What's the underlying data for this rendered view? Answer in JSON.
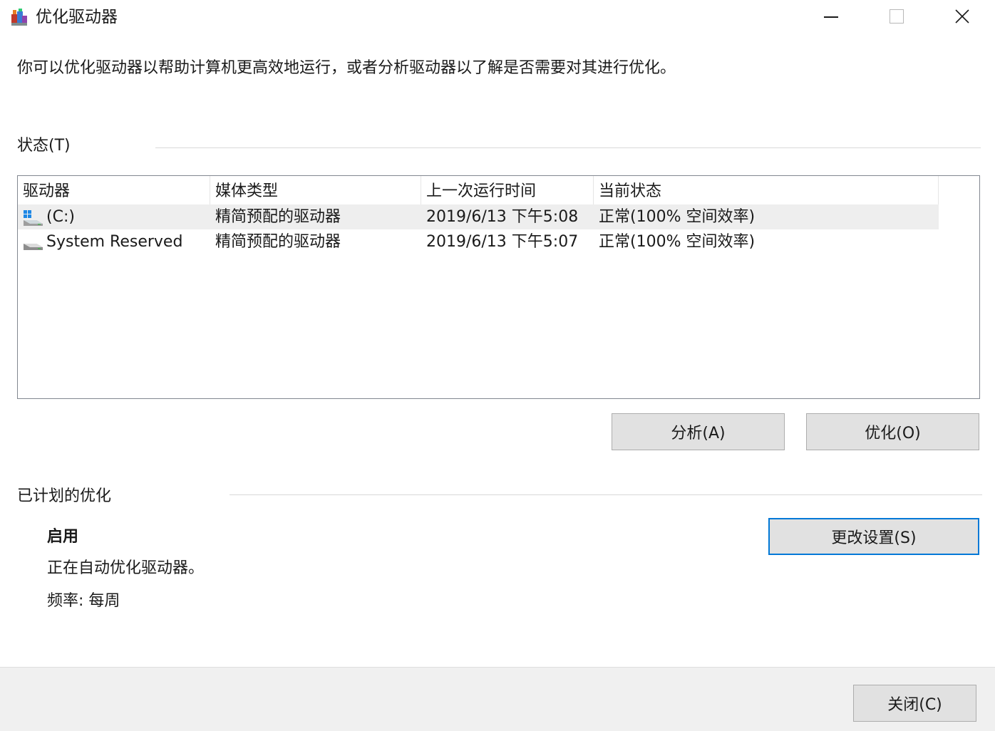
{
  "window": {
    "title": "优化驱动器",
    "icons": {
      "app": "defrag-app-icon",
      "minimize": "minimize-icon",
      "maximize": "maximize-icon",
      "close": "close-icon"
    }
  },
  "intro_text": "你可以优化驱动器以帮助计算机更高效地运行，或者分析驱动器以了解是否需要对其进行优化。",
  "status_section": {
    "label": "状态(T)",
    "columns": [
      "驱动器",
      "媒体类型",
      "上一次运行时间",
      "当前状态"
    ],
    "drives": [
      {
        "name": "(C:)",
        "icon": "windows-drive-icon",
        "media_type": "精简预配的驱动器",
        "last_run": "2019/6/13 下午5:08",
        "status": "正常(100% 空间效率)",
        "selected": true
      },
      {
        "name": "System Reserved",
        "icon": "drive-icon",
        "media_type": "精简预配的驱动器",
        "last_run": "2019/6/13 下午5:07",
        "status": "正常(100% 空间效率)",
        "selected": false
      }
    ],
    "analyze_button": "分析(A)",
    "optimize_button": "优化(O)"
  },
  "scheduled_section": {
    "label": "已计划的优化",
    "state": "启用",
    "description": "正在自动优化驱动器。",
    "frequency": "频率: 每周",
    "change_settings_button": "更改设置(S)"
  },
  "close_button": "关闭(C)",
  "colors": {
    "focus_border": "#0078d7",
    "selected_row": "#eeeeee",
    "button_face": "#e1e1e1",
    "footer": "#f0f0f0"
  }
}
